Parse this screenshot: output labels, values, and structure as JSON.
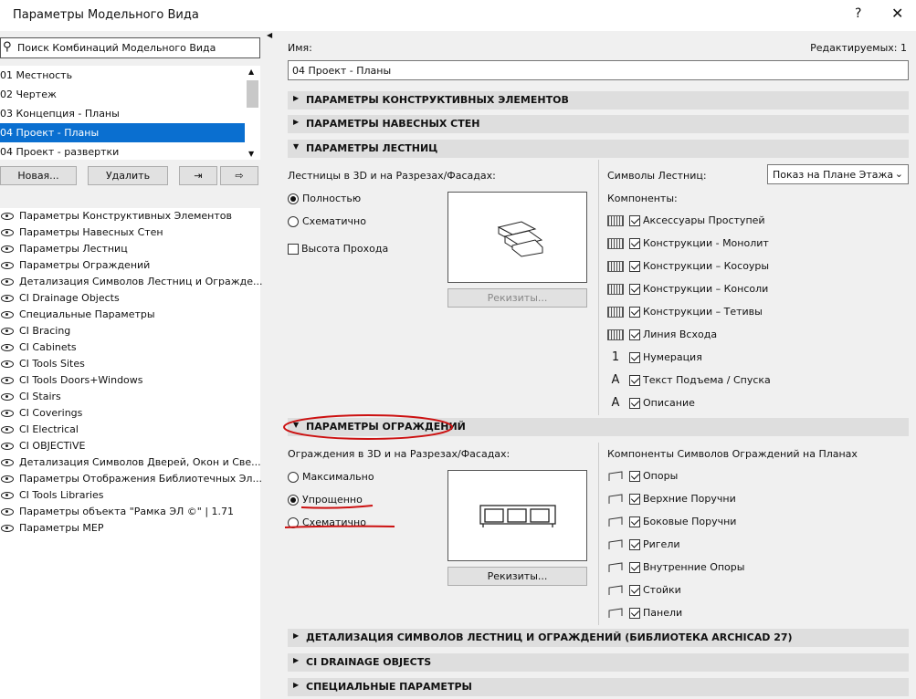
{
  "window": {
    "title": "Параметры Модельного Вида",
    "help": "?",
    "close": "✕"
  },
  "left": {
    "search_placeholder": "Поиск Комбинаций Модельного Вида",
    "combos": [
      "01 Местность",
      "02 Чертеж",
      "03 Концепция - Планы",
      "04 Проект - Планы",
      "04 Проект - развертки"
    ],
    "selected_index": 3,
    "new_label": "Новая...",
    "delete_label": "Удалить",
    "tree": [
      "Параметры Конструктивных Элементов",
      "Параметры Навесных Стен",
      "Параметры Лестниц",
      "Параметры Ограждений",
      "Детализация Символов Лестниц и Огражде...",
      "CI Drainage Objects",
      "Специальные Параметры",
      "CI Bracing",
      "CI Cabinets",
      "CI Tools Sites",
      "CI Tools Doors+Windows",
      "CI Stairs",
      "CI Coverings",
      "CI Electrical",
      "CI OBJECTiVE",
      "Детализация Символов Дверей, Окон и Све...",
      "Параметры Отображения Библиотечных Эл...",
      "CI Tools Libraries",
      "Параметры объекта \"Рамка ЭЛ ©\" | 1.71",
      "Параметры MEP"
    ]
  },
  "right": {
    "name_label": "Имя:",
    "editable": "Редактируемых: 1",
    "name_value": "04 Проект - Планы",
    "sections_top": [
      "ПАРАМЕТРЫ КОНСТРУКТИВНЫХ ЭЛЕМЕНТОВ",
      "ПАРАМЕТРЫ НАВЕСНЫХ СТЕН",
      "ПАРАМЕТРЫ ЛЕСТНИЦ"
    ],
    "stairs": {
      "label": "Лестницы в 3D и на Разрезах/Фасадах:",
      "opt_full": "Полностью",
      "opt_schematic": "Схематично",
      "headroom": "Высота Прохода",
      "details_btn": "Рекизиты...",
      "symbols_label": "Символы Лестниц:",
      "symbols_value": "Показ на Плане Этажа",
      "components_label": "Компоненты:",
      "components": [
        "Аксессуары Проступей",
        "Конструкции - Монолит",
        "Конструкции – Косоуры",
        "Конструкции – Консоли",
        "Конструкции – Тетивы",
        "Линия Всхода",
        "Нумерация",
        "Текст Подъема / Спуска",
        "Описание"
      ]
    },
    "railing_header": "ПАРАМЕТРЫ ОГРАЖДЕНИЙ",
    "railings": {
      "label": "Ограждения в 3D и на Разрезах/Фасадах:",
      "opt_max": "Максимально",
      "opt_simple": "Упрощенно",
      "opt_schematic": "Схематично",
      "details_btn": "Рекизиты...",
      "components_label": "Компоненты Символов Ограждений на Планах",
      "components": [
        "Опоры",
        "Верхние Поручни",
        "Боковые Поручни",
        "Ригели",
        "Внутренние Опоры",
        "Стойки",
        "Панели"
      ]
    },
    "sections_bottom": [
      "ДЕТАЛИЗАЦИЯ СИМВОЛОВ ЛЕСТНИЦ И ОГРАЖДЕНИЙ (БИБЛИОТЕКА ARCHICAD 27)",
      "CI DRAINAGE OBJECTS",
      "СПЕЦИАЛЬНЫЕ ПАРАМЕТРЫ"
    ]
  },
  "annotation_color": "#cc1111"
}
